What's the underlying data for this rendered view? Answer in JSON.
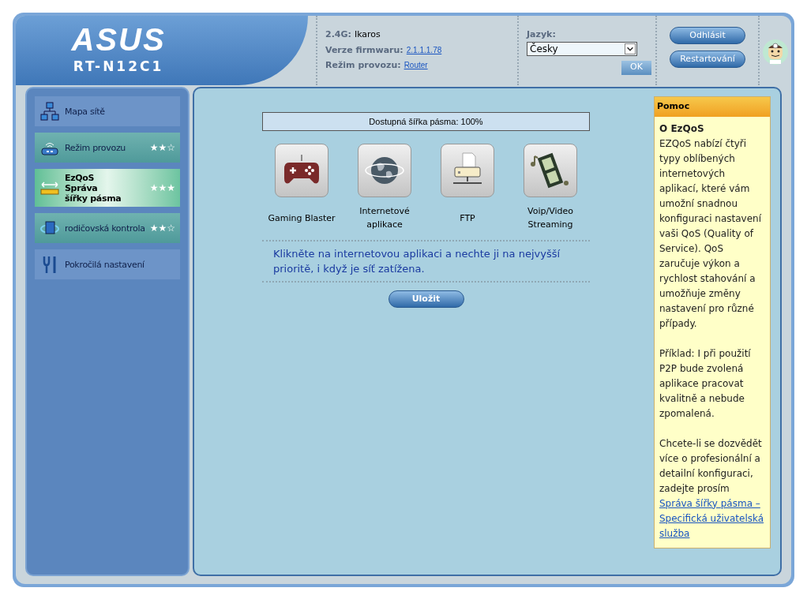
{
  "logo": {
    "brand": "ASUS",
    "model": "RT-N12C1"
  },
  "info": [
    {
      "label": "2.4G:",
      "value": "Ikaros",
      "link": false
    },
    {
      "label": "Verze firmwaru:",
      "value": "2.1.1.1.78",
      "link": true
    },
    {
      "label": "Režim provozu:",
      "value": "Router",
      "link": true
    }
  ],
  "language": {
    "label": "Jazyk:",
    "value": "Česky",
    "ok": "OK"
  },
  "buttons": [
    "Odhlásit",
    "Restartování"
  ],
  "menu": [
    {
      "label": "Mapa sítě",
      "kind": "map",
      "selected": false
    },
    {
      "label": "Režim provozu",
      "kind": "router",
      "selected": false,
      "stars": 2
    },
    {
      "label": "EzQoS\nSpráva\nšířky pásma",
      "kind": "qos",
      "selected": true,
      "stars": 3
    },
    {
      "label": "rodičovská kontrola",
      "kind": "parental",
      "selected": false,
      "stars": 2
    },
    {
      "label": "Pokročilá nastavení",
      "kind": "tools",
      "selected": false
    }
  ],
  "bandwidth": "Dostupná šířka pásma: 100%",
  "apps": [
    {
      "label": "Gaming Blaster",
      "kind": "game"
    },
    {
      "label": "Internetové\naplikace",
      "kind": "globe"
    },
    {
      "label": "FTP",
      "kind": "ftp"
    },
    {
      "label": "Voip/Video\nStreaming",
      "kind": "video"
    }
  ],
  "hint": "Klikněte na internetovou aplikaci a nechte ji na nejvyšší prioritě, i když je síť zatížena.",
  "save": "Uložit",
  "help": {
    "title": "Pomoc",
    "heading": "O EzQoS",
    "paragraphs": [
      {
        "text": "EZQoS nabízí čtyři typy oblíbených internetových aplikací, které vám umožní snadnou konfiguraci nastavení vaši QoS (Quality of Service). QoS zaručuje výkon a rychlost stahování a umožňuje změny nastavení pro různé případy."
      },
      {
        "text": "Příklad: I při použití P2P bude zvolená aplikace pracovat kvalitně a nebude zpomalená."
      },
      {
        "text": "Chcete-li se dozvědět více o profesionální a detailní konfiguraci, zadejte prosím",
        "link": "Správa šířky pásma – Specifická uživatelská služba"
      }
    ]
  }
}
